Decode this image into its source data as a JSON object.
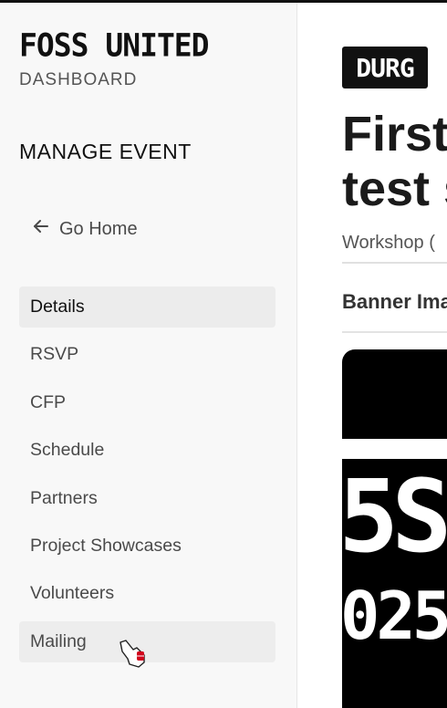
{
  "brand": {
    "logo_text": "FOSS UNITED",
    "subtitle": "DASHBOARD"
  },
  "sidebar": {
    "section_title": "MANAGE EVENT",
    "go_home_label": "Go Home",
    "items": [
      {
        "label": "Details",
        "active": true
      },
      {
        "label": "RSVP"
      },
      {
        "label": "CFP"
      },
      {
        "label": "Schedule"
      },
      {
        "label": "Partners"
      },
      {
        "label": "Project Showcases"
      },
      {
        "label": "Volunteers"
      },
      {
        "label": "Mailing"
      }
    ]
  },
  "main": {
    "city_badge": "DURG",
    "event_title": "First\ntest s",
    "event_type": "Workshop  (",
    "banner_heading": "Banner Ima",
    "banner_text_line1": "5S",
    "banner_text_line2": "025"
  },
  "colors": {
    "accent": "#111111",
    "sidebar_bg": "#f8f8f8",
    "active_item_bg": "#ececec"
  }
}
